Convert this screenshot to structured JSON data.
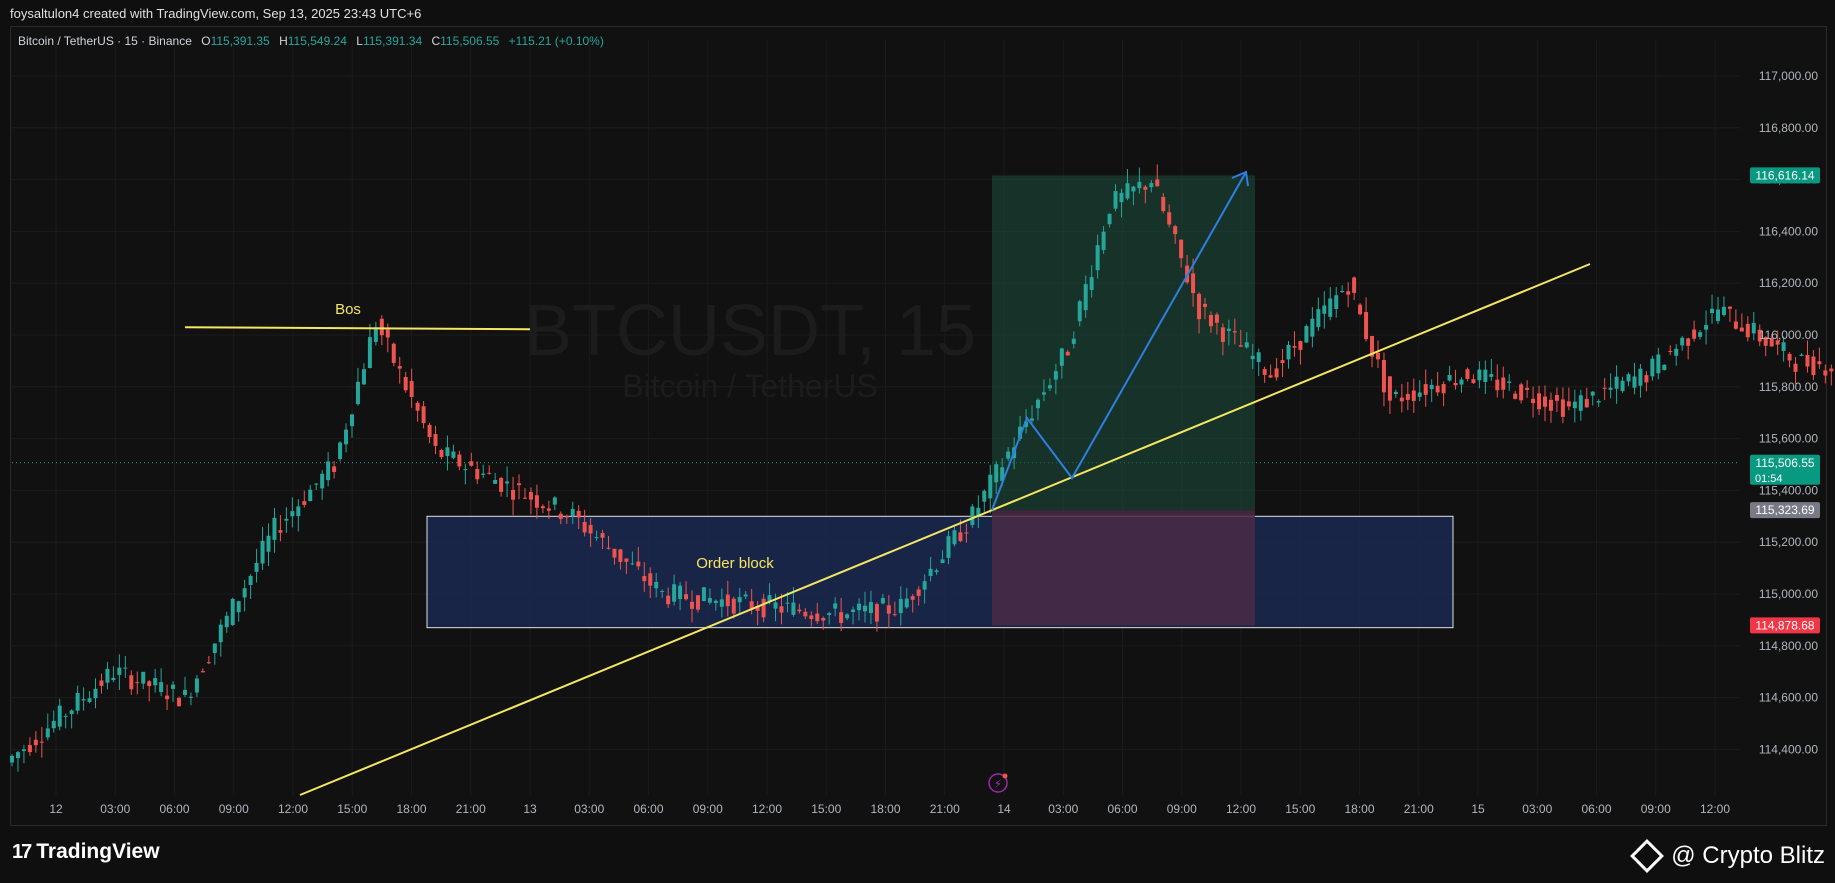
{
  "attribution": "foysaltulon4 created with TradingView.com, Sep 13, 2025 23:43 UTC+6",
  "legend": {
    "symbol": "Bitcoin / TetherUS · 15 · Binance",
    "open_label": "O",
    "open": "115,391.35",
    "high_label": "H",
    "high": "115,549.24",
    "low_label": "L",
    "low": "115,391.34",
    "close_label": "C",
    "close": "115,506.55",
    "change": "+115.21 (+0.10%)"
  },
  "watermark": {
    "ticker": "BTCUSDT, 15",
    "name": "Bitcoin / TetherUS"
  },
  "footer": {
    "brand": "TradingView",
    "credit": "@ Crypto Blitz"
  },
  "colors": {
    "up": "#26a69a",
    "down": "#ef5350",
    "trend": "#f5e663",
    "arrow": "#2f7fe0",
    "ob_fill": "#1a2a55",
    "tp_zone": "#1b4a3a",
    "sl_zone": "#4a2a45"
  },
  "chart_data": {
    "type": "candlestick",
    "symbol": "BTCUSDT",
    "timeframe": "15",
    "exchange": "Binance",
    "ylim": [
      114200,
      117200
    ],
    "y_ticks": [
      "117,000.00",
      "116,800.00",
      "116,600.00",
      "116,400.00",
      "116,200.00",
      "116,000.00",
      "115,800.00",
      "115,600.00",
      "115,400.00",
      "115,200.00",
      "115,000.00",
      "114,800.00",
      "114,600.00",
      "114,400.00"
    ],
    "x_ticks": [
      "12",
      "03:00",
      "06:00",
      "09:00",
      "12:00",
      "15:00",
      "18:00",
      "21:00",
      "13",
      "03:00",
      "06:00",
      "09:00",
      "12:00",
      "15:00",
      "18:00",
      "21:00",
      "14",
      "03:00",
      "06:00",
      "09:00",
      "12:00",
      "15:00",
      "18:00",
      "21:00",
      "15",
      "03:00",
      "06:00",
      "09:00",
      "12:00"
    ],
    "price_labels": [
      {
        "value": 116616.14,
        "text": "116,616.14",
        "color": "#089981"
      },
      {
        "value": 115506.55,
        "text": "115,506.55",
        "sub": "01:54",
        "color": "#089981"
      },
      {
        "value": 115323.69,
        "text": "115,323.69",
        "color": "#787b86"
      },
      {
        "value": 114878.68,
        "text": "114,878.68",
        "color": "#f23645"
      }
    ],
    "annotations": [
      {
        "type": "text",
        "text": "Bos",
        "price": 116100
      },
      {
        "type": "text",
        "text": "Order block",
        "price": 115120
      }
    ],
    "order_block": {
      "top": 115300,
      "bottom": 114870
    },
    "position": {
      "entry": 115323.69,
      "target": 116616.14,
      "stop": 114878.68
    },
    "bos_level": 116030,
    "path": [
      {
        "ts": 0,
        "p": 114350
      },
      {
        "ts": 18,
        "p": 114700
      },
      {
        "ts": 30,
        "p": 114600
      },
      {
        "ts": 45,
        "p": 115250
      },
      {
        "ts": 55,
        "p": 115500
      },
      {
        "ts": 62,
        "p": 116050
      },
      {
        "ts": 72,
        "p": 115550
      },
      {
        "ts": 95,
        "p": 115300
      },
      {
        "ts": 110,
        "p": 115000
      },
      {
        "ts": 140,
        "p": 114920
      },
      {
        "ts": 150,
        "p": 114950
      },
      {
        "ts": 162,
        "p": 115300
      },
      {
        "ts": 178,
        "p": 115950
      },
      {
        "ts": 185,
        "p": 116500
      },
      {
        "ts": 192,
        "p": 116600
      },
      {
        "ts": 200,
        "p": 116100
      },
      {
        "ts": 212,
        "p": 115850
      },
      {
        "ts": 225,
        "p": 116200
      },
      {
        "ts": 232,
        "p": 115750
      },
      {
        "ts": 245,
        "p": 115850
      },
      {
        "ts": 262,
        "p": 115720
      },
      {
        "ts": 275,
        "p": 115850
      },
      {
        "ts": 287,
        "p": 116100
      },
      {
        "ts": 300,
        "p": 115900
      },
      {
        "ts": 315,
        "p": 115850
      },
      {
        "ts": 325,
        "p": 115400
      },
      {
        "ts": 332,
        "p": 115320
      },
      {
        "ts": 335,
        "p": 115500
      }
    ]
  }
}
